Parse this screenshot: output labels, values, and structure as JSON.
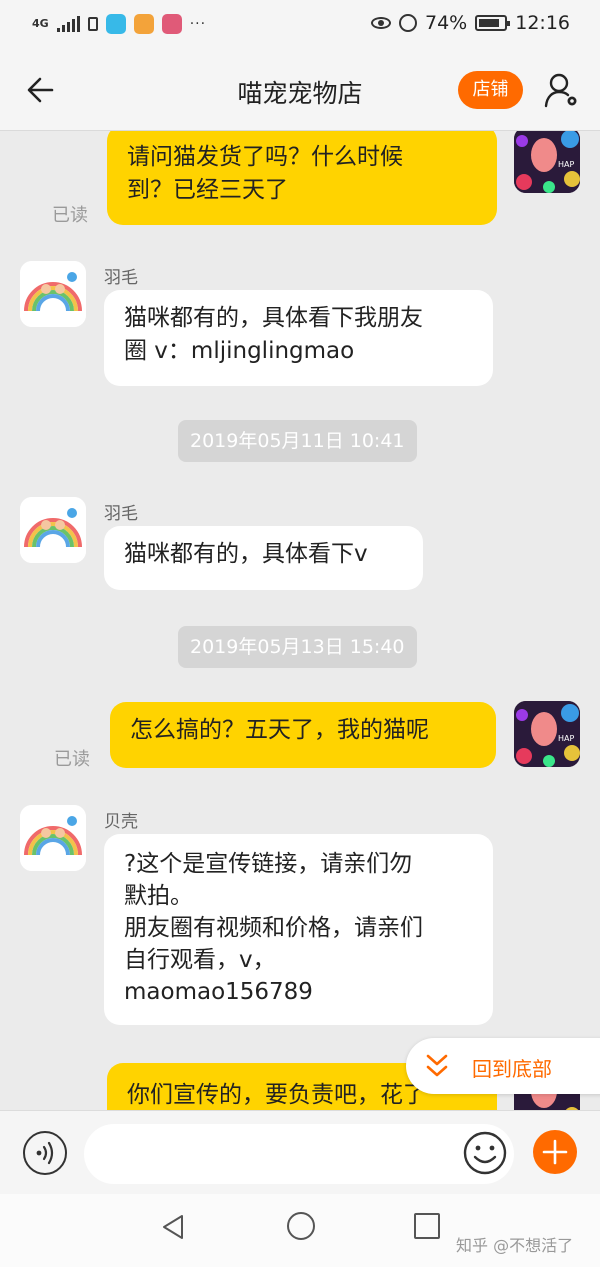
{
  "status_bar": {
    "network": "4G",
    "battery_percent": "74%",
    "time": "12:16",
    "app_icon_colors": [
      "#37b9e8",
      "#f3a33a",
      "#e05a78"
    ],
    "more": "···"
  },
  "header": {
    "back_icon": "arrow-left-icon",
    "title": "喵宠宠物店",
    "shop_button": "店铺",
    "profile_icon": "user-settings-icon"
  },
  "colors": {
    "accent": "#ff6a00",
    "my_bubble": "#ffd300",
    "their_bubble": "#ffffff",
    "chat_background": "#ebebeb"
  },
  "chat": {
    "messages": [
      {
        "from": "me",
        "text": "请问猫发货了吗？什么时候\n到？已经三天了",
        "read": "已读"
      },
      {
        "from": "shop",
        "sender": "羽毛",
        "text": "猫咪都有的，具体看下我朋友\n圈 v：mljinglingmao"
      },
      {
        "type": "timestamp",
        "text": "2019年05月11日 10:41"
      },
      {
        "from": "shop",
        "sender": "羽毛",
        "text": "猫咪都有的，具体看下v"
      },
      {
        "type": "timestamp",
        "text": "2019年05月13日 15:40"
      },
      {
        "from": "me",
        "text": "怎么搞的？五天了，我的猫呢",
        "read": "已读"
      },
      {
        "from": "shop",
        "sender": "贝壳",
        "text": "?这个是宣传链接，请亲们勿\n默拍。\n朋友圈有视频和价格，请亲们\n自行观看，v，\nmaomao156789"
      },
      {
        "from": "me",
        "text": "你们宣传的，要负责吧，花了"
      }
    ],
    "scroll_to_bottom": "回到底部"
  },
  "input_bar": {
    "voice_icon": "voice-icon",
    "placeholder": "",
    "emoji_icon": "emoji-icon",
    "plus_icon": "plus-icon"
  },
  "nav_bar": {
    "back_icon": "nav-back-icon",
    "home_icon": "nav-home-icon",
    "recent_icon": "nav-recent-icon",
    "watermark": "知乎 @不想活了"
  }
}
